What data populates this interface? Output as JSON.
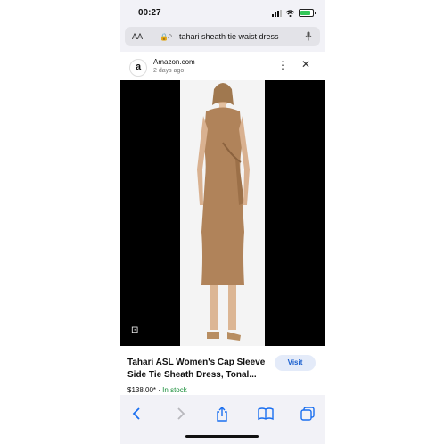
{
  "status_bar": {
    "time": "00:27"
  },
  "address_bar": {
    "text_size_label": "AA",
    "query": "tahari sheath tie waist dress"
  },
  "result": {
    "source_name": "Amazon.com",
    "posted": "2 days ago",
    "logo_letter": "a",
    "product_title": "Tahari ASL Women's Cap Sleeve Side Tie Sheath Dress, Tonal...",
    "price": "$138.00*",
    "separator": "·",
    "availability": "In stock",
    "visit_label": "Visit"
  },
  "colors": {
    "accent": "#1a6ff0",
    "dress": "#b0835a",
    "in_stock": "#1a8f3a"
  },
  "icons": {
    "toolbar": [
      "back-icon",
      "forward-icon",
      "share-icon",
      "bookmarks-icon",
      "tabs-icon"
    ]
  }
}
